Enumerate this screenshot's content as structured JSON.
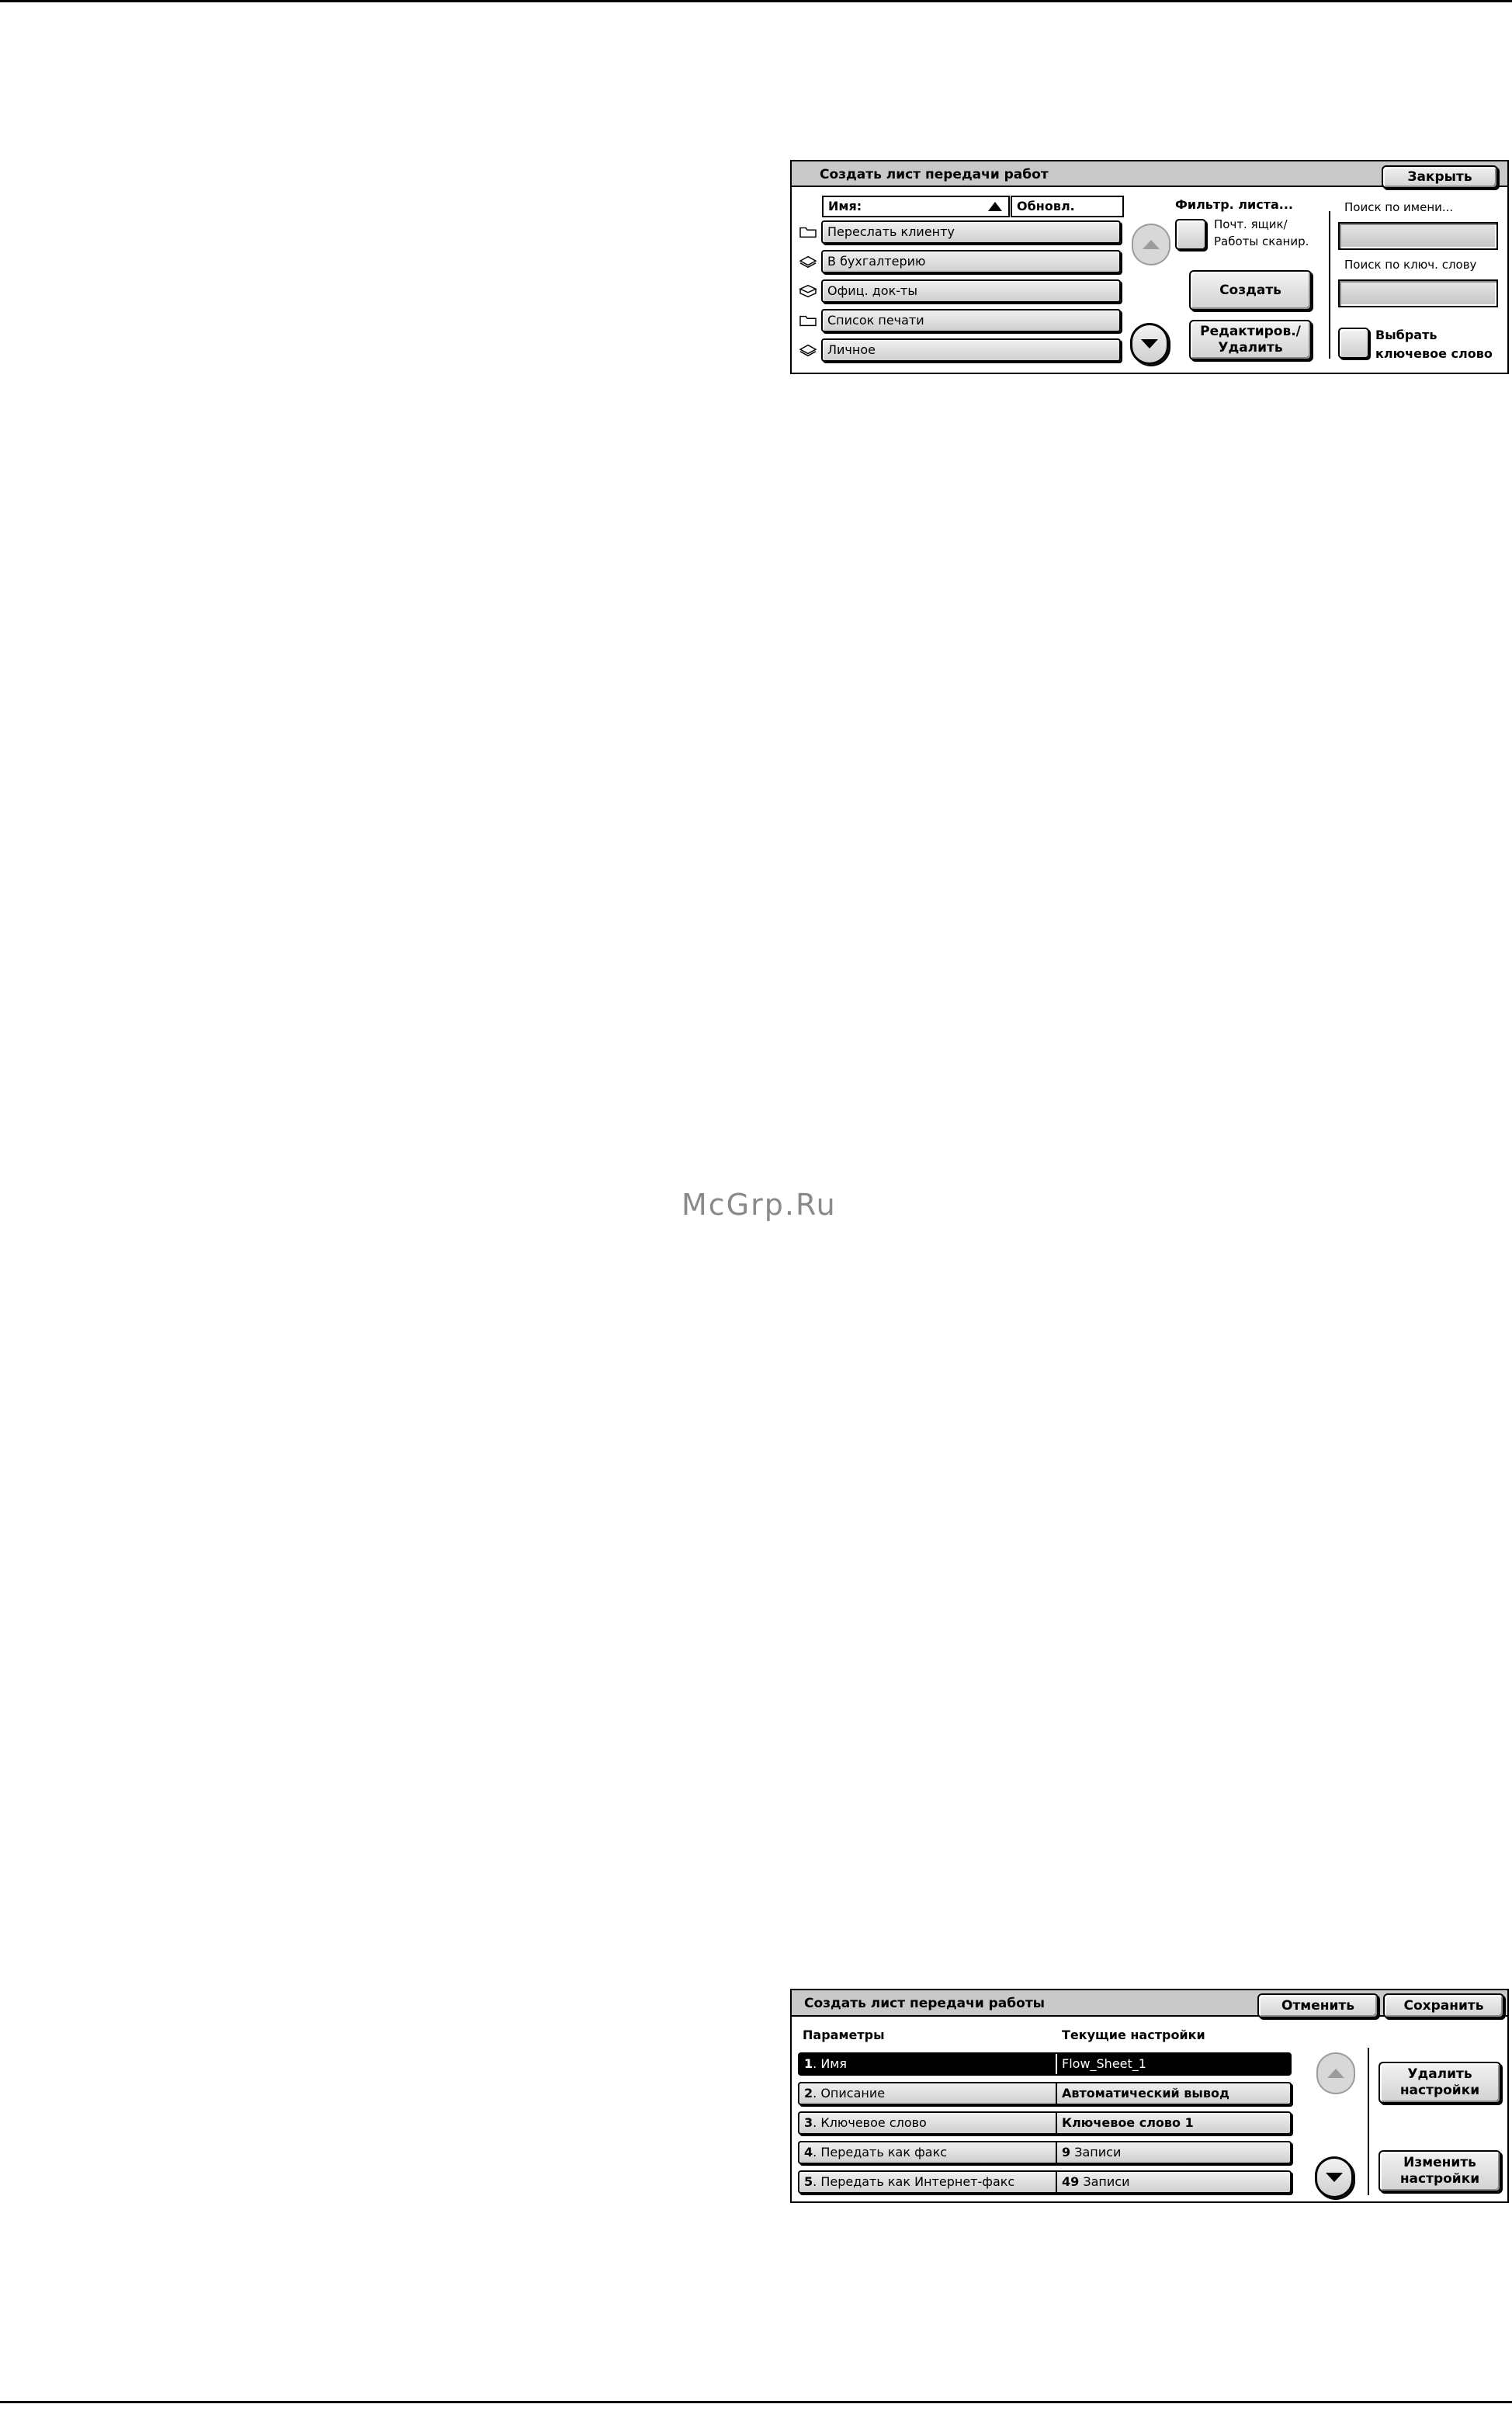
{
  "watermark": "McGrp.Ru",
  "panel1": {
    "title": "Создать лист передачи работ",
    "close_label": "Закрыть",
    "sort_name": "Имя:",
    "sort_updated": "Обновл.",
    "rows": [
      {
        "label": "Переслать клиенту",
        "icon": "folder-icon"
      },
      {
        "label": "В бухгалтерию",
        "icon": "stack-icon"
      },
      {
        "label": "Офиц. док-ты",
        "icon": "open-stack-icon"
      },
      {
        "label": "Список печати",
        "icon": "folder-icon"
      },
      {
        "label": "Личное",
        "icon": "stack-icon"
      }
    ],
    "filter_title": "Фильтр. листа...",
    "filter_line1": "Почт. ящик/",
    "filter_line2": "Работы сканир.",
    "create_label": "Создать",
    "edit_line1": "Редактиров./",
    "edit_line2": "Удалить",
    "search_name_label": "Поиск по имени...",
    "search_keyword_label": "Поиск по ключ. слову",
    "select_kw_line1": "Выбрать",
    "select_kw_line2": "ключевое слово"
  },
  "panel2": {
    "title": "Создать лист передачи работы",
    "cancel_label": "Отменить",
    "save_label": "Сохранить",
    "col_params": "Параметры",
    "col_current": "Текущие настройки",
    "rows": [
      {
        "num": "1",
        "label": ". Имя",
        "value_bold": "",
        "value": "Flow_Sheet_1",
        "selected": true
      },
      {
        "num": "2",
        "label": ". Описание",
        "value_bold": "Автоматический вывод",
        "value": "",
        "selected": false
      },
      {
        "num": "3",
        "label": ". Ключевое слово",
        "value_bold": "Ключевое слово 1",
        "value": "",
        "selected": false
      },
      {
        "num": "4",
        "label": ". Передать как факс",
        "value_bold": "9",
        "value": " Записи",
        "selected": false
      },
      {
        "num": "5",
        "label": ". Передать как Интернет-факс",
        "value_bold": "49",
        "value": " Записи",
        "selected": false
      }
    ],
    "delete_line1": "Удалить",
    "delete_line2": "настройки",
    "change_line1": "Изменить",
    "change_line2": "настройки"
  }
}
